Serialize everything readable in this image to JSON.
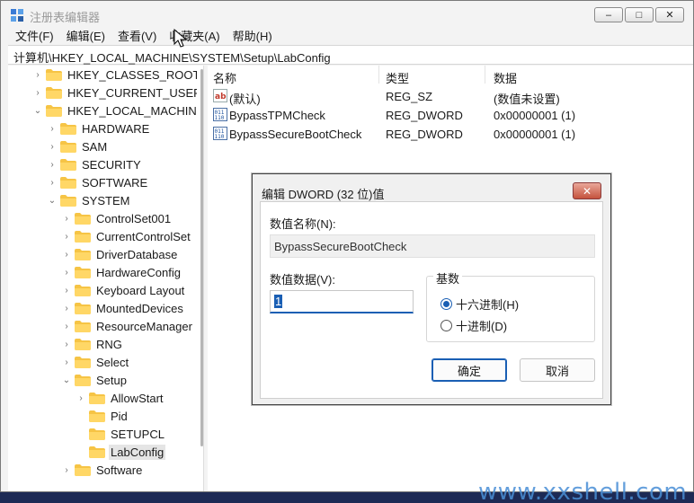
{
  "window": {
    "title": "注册表编辑器",
    "controls": {
      "minimize": "–",
      "maximize": "□",
      "close": "✕"
    }
  },
  "menu": [
    "文件(F)",
    "编辑(E)",
    "查看(V)",
    "收藏夹(A)",
    "帮助(H)"
  ],
  "address": "计算机\\HKEY_LOCAL_MACHINE\\SYSTEM\\Setup\\LabConfig",
  "tree": [
    {
      "label": "HKEY_CLASSES_ROOT",
      "expanded": false
    },
    {
      "label": "HKEY_CURRENT_USER",
      "expanded": false
    },
    {
      "label": "HKEY_LOCAL_MACHINE",
      "expanded": true
    },
    {
      "label": "HARDWARE",
      "expanded": false
    },
    {
      "label": "SAM",
      "expanded": false
    },
    {
      "label": "SECURITY",
      "expanded": false
    },
    {
      "label": "SOFTWARE",
      "expanded": false
    },
    {
      "label": "SYSTEM",
      "expanded": true
    },
    {
      "label": "ControlSet001",
      "expanded": false
    },
    {
      "label": "CurrentControlSet",
      "expanded": false
    },
    {
      "label": "DriverDatabase",
      "expanded": false
    },
    {
      "label": "HardwareConfig",
      "expanded": false
    },
    {
      "label": "Keyboard Layout",
      "expanded": false
    },
    {
      "label": "MountedDevices",
      "expanded": false
    },
    {
      "label": "ResourceManager",
      "expanded": false
    },
    {
      "label": "RNG",
      "expanded": false
    },
    {
      "label": "Select",
      "expanded": false
    },
    {
      "label": "Setup",
      "expanded": true
    },
    {
      "label": "AllowStart",
      "expanded": false
    },
    {
      "label": "Pid",
      "expanded": null
    },
    {
      "label": "SETUPCL",
      "expanded": null
    },
    {
      "label": "LabConfig",
      "expanded": null,
      "selected": true
    },
    {
      "label": "Software",
      "expanded": false
    }
  ],
  "list": {
    "columns": [
      "名称",
      "类型",
      "数据"
    ],
    "rows": [
      {
        "icon": "string-value-icon",
        "name": "(默认)",
        "type": "REG_SZ",
        "data": "(数值未设置)"
      },
      {
        "icon": "dword-value-icon",
        "name": "BypassTPMCheck",
        "type": "REG_DWORD",
        "data": "0x00000001 (1)"
      },
      {
        "icon": "dword-value-icon",
        "name": "BypassSecureBootCheck",
        "type": "REG_DWORD",
        "data": "0x00000001 (1)"
      }
    ]
  },
  "dialog": {
    "title": "编辑 DWORD (32 位)值",
    "close": "✕",
    "name_label": "数值名称(N):",
    "name_value": "BypassSecureBootCheck",
    "data_label": "数值数据(V):",
    "data_value": "1",
    "base_label": "基数",
    "hex_label": "十六进制(H)",
    "dec_label": "十进制(D)",
    "selected_base": "hex",
    "ok": "确定",
    "cancel": "取消"
  },
  "watermark": "www.xxshell.com",
  "colors": {
    "accent": "#1a5fb4",
    "folder": "#f6c445",
    "desktop": "#1d2a55"
  }
}
